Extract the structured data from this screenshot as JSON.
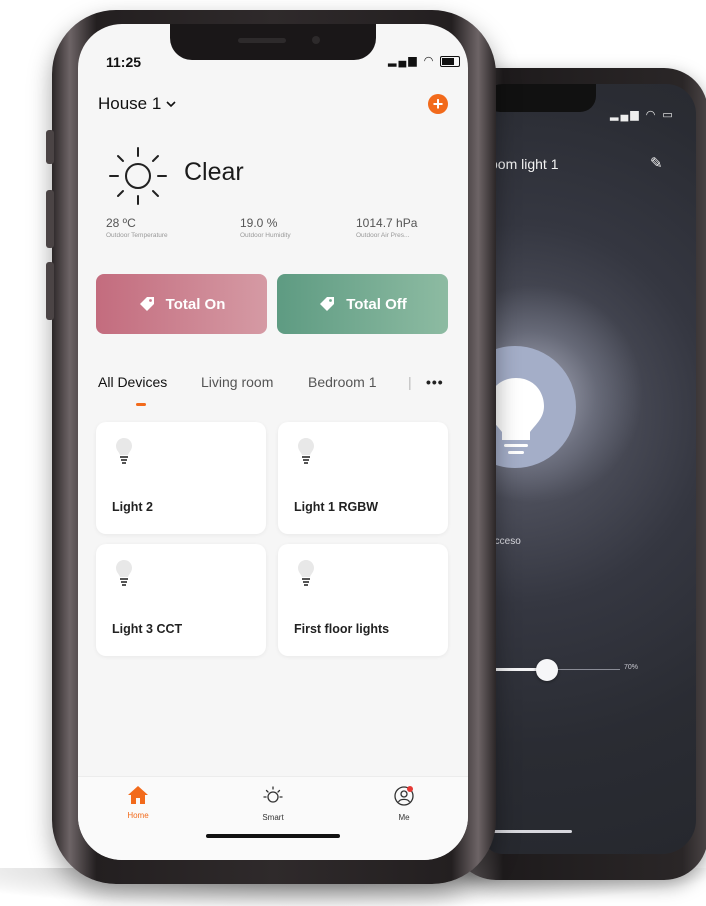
{
  "colors": {
    "accent": "#f26a1b",
    "total_on_bg": "#c9788a",
    "total_off_bg": "#6fa98e",
    "screen_bg": "#f6f6f6"
  },
  "status_bar": {
    "time": "11:25",
    "icons": [
      "signal-icon",
      "wifi-icon",
      "battery-icon"
    ]
  },
  "header": {
    "house_name": "House 1",
    "house_dropdown_icon": "chevron-down-icon",
    "add_icon": "plus-icon"
  },
  "weather": {
    "icon": "sun-icon",
    "condition": "Clear",
    "stats": [
      {
        "value": "28 ºC",
        "label": "Outdoor Temperature"
      },
      {
        "value": "19.0 %",
        "label": "Outdoor Humidity"
      },
      {
        "value": "1014.7 hPa",
        "label": "Outdoor Air Pres..."
      }
    ]
  },
  "scenes": {
    "total_on": "Total On",
    "total_off": "Total Off",
    "icon": "tag-icon"
  },
  "room_tabs": {
    "items": [
      "All Devices",
      "Living room",
      "Bedroom 1"
    ],
    "active_index": 0,
    "more_icon": "more-horizontal-icon"
  },
  "devices": [
    {
      "name": "Light 2",
      "icon": "bulb-icon"
    },
    {
      "name": "Light 1 RGBW",
      "icon": "bulb-icon"
    },
    {
      "name": "Light 3 CCT",
      "icon": "bulb-icon"
    },
    {
      "name": "First floor lights",
      "icon": "bulb-icon"
    }
  ],
  "bottom_nav": {
    "items": [
      {
        "label": "Home",
        "icon": "home-icon",
        "active": true
      },
      {
        "label": "Smart",
        "icon": "sun-icon",
        "active": false
      },
      {
        "label": "Me",
        "icon": "user-icon",
        "active": false
      }
    ]
  },
  "back_phone": {
    "title": "oom light 1",
    "edit_icon": "edit-icon",
    "state_label": "Acceso",
    "brightness_label": "70%",
    "brightness": 0.7
  }
}
